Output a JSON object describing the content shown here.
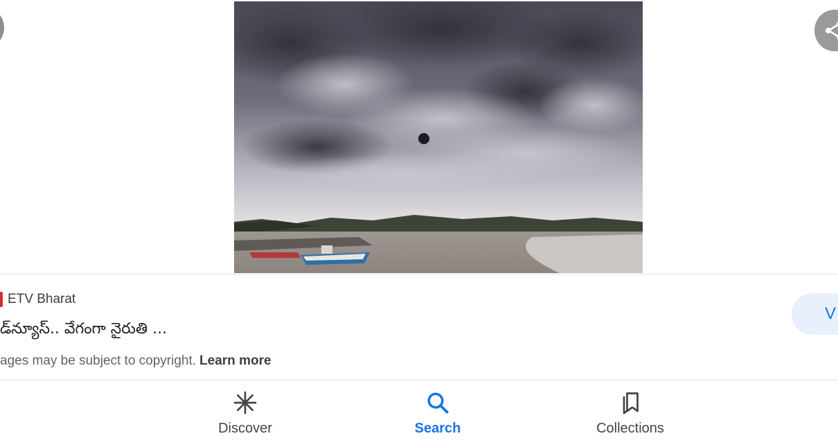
{
  "image_viewer": {
    "image_alt": "storm-clouds-over-beach-with-boats",
    "source": {
      "name": "ETV Bharat",
      "favicon_color": "#d32f2f"
    },
    "title": "డ్‌న్యూస్.. వేగంగా నైరుతి ...",
    "copyright_text": "ages may be subject to copyright.",
    "learn_more_label": "Learn more",
    "visit_button_label": "V",
    "accent_color": "#1a73e8"
  },
  "bottom_nav": {
    "items": [
      {
        "label": "Discover",
        "icon": "asterisk-icon",
        "active": false
      },
      {
        "label": "Search",
        "icon": "search-icon",
        "active": true
      },
      {
        "label": "Collections",
        "icon": "bookmarks-icon",
        "active": false
      }
    ]
  }
}
